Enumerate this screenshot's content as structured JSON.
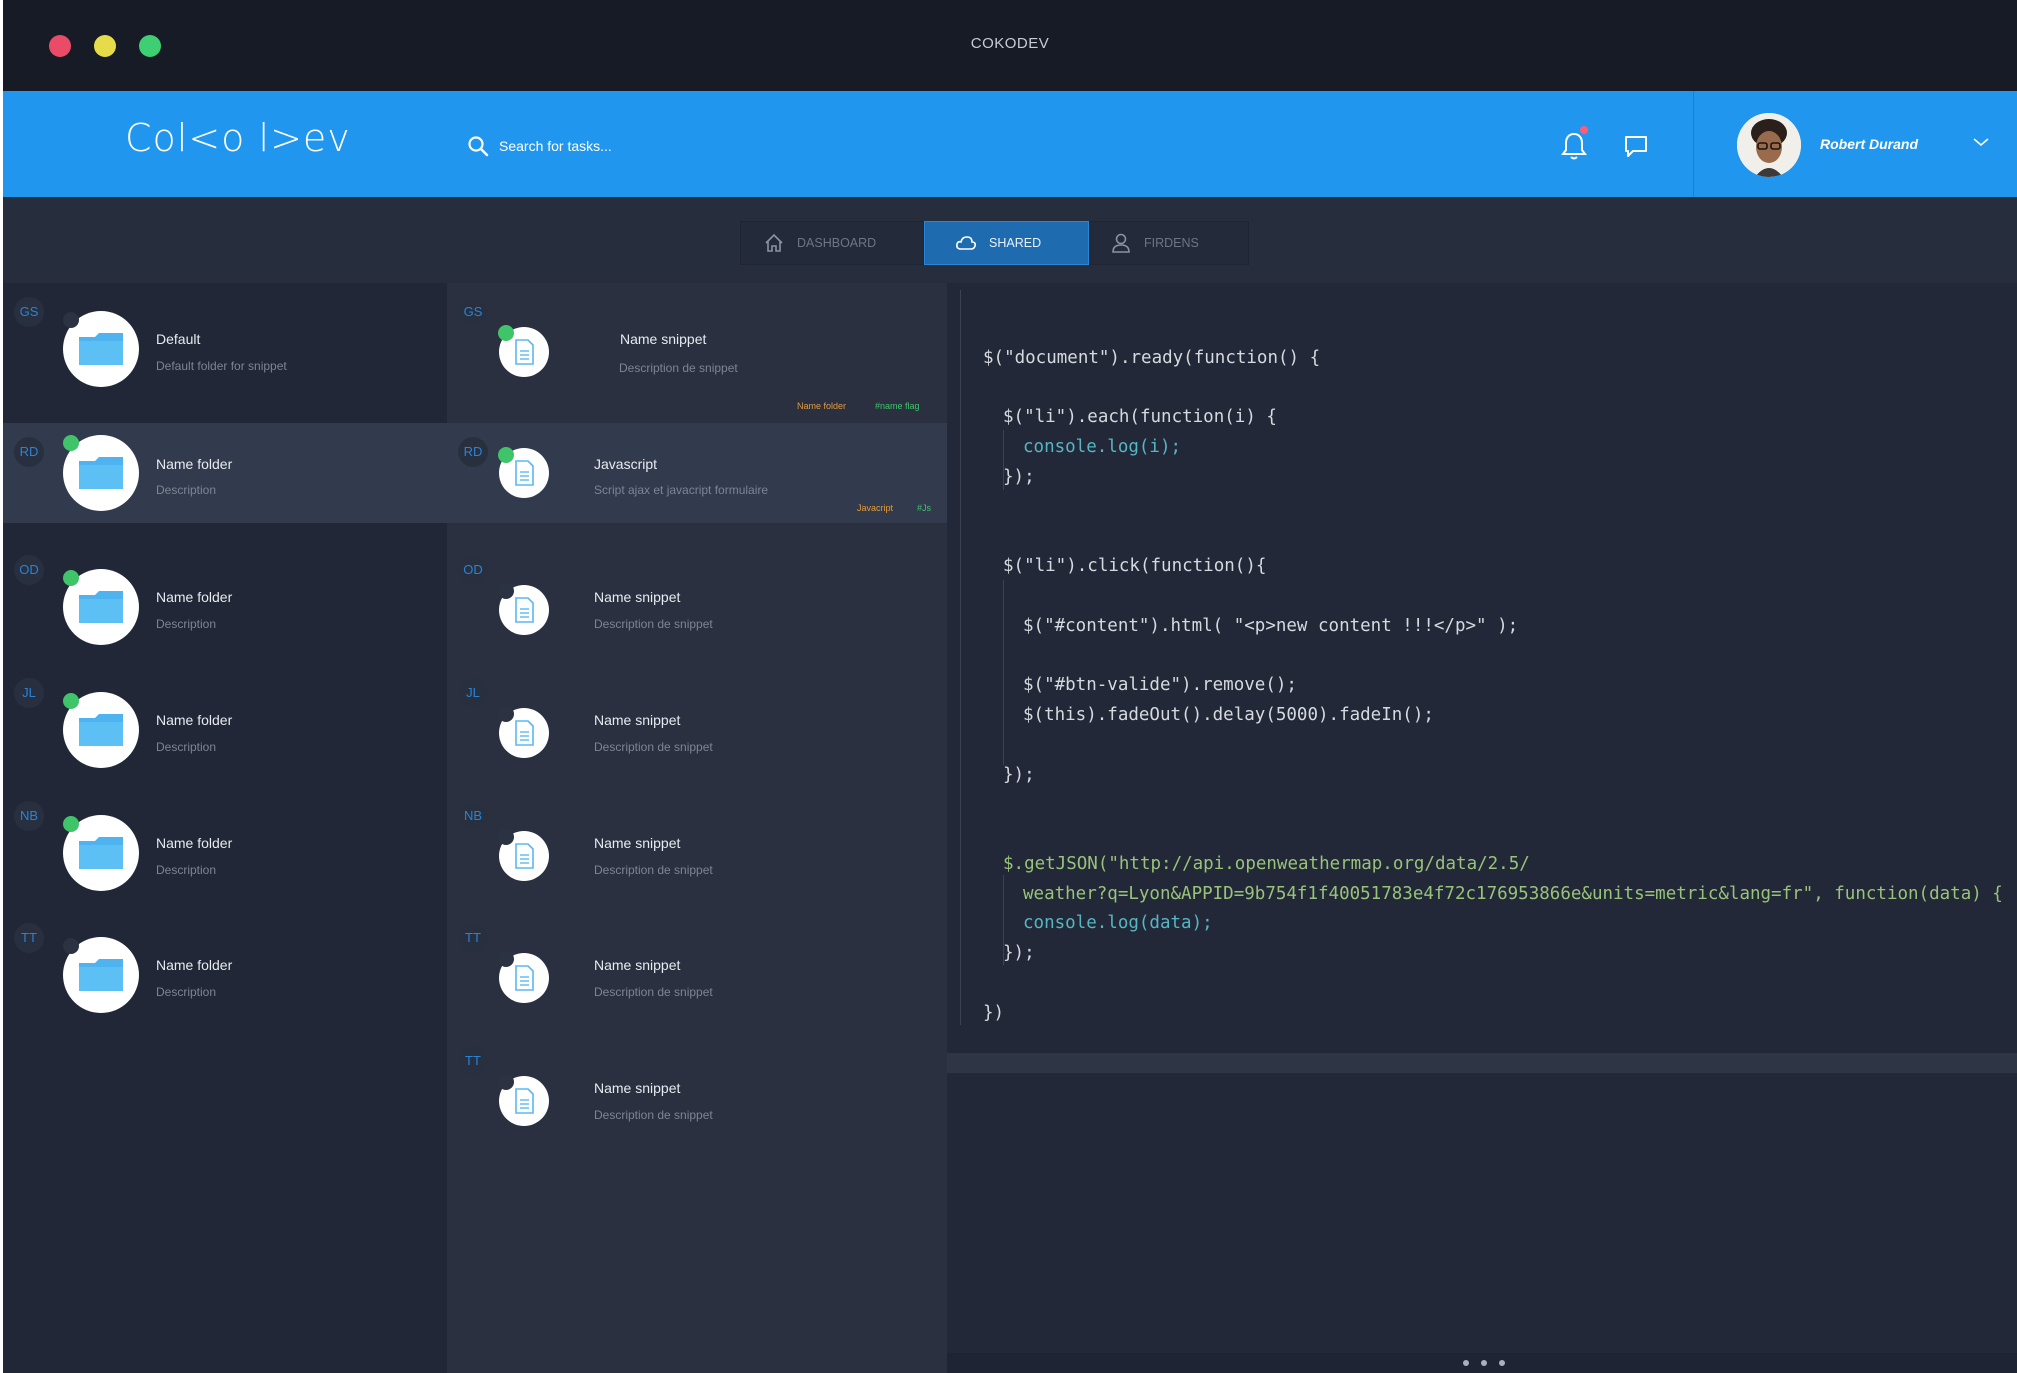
{
  "window": {
    "title": "COKODEV"
  },
  "header": {
    "logo": "Col<o l>ev",
    "search_placeholder": "Search for tasks...",
    "user_name": "Robert Durand"
  },
  "tabs": [
    {
      "label": "DASHBOARD",
      "icon": "home-icon"
    },
    {
      "label": "SHARED",
      "icon": "cloud-icon",
      "active": true
    },
    {
      "label": "FIRDENS",
      "icon": "user-icon"
    }
  ],
  "folders": [
    {
      "initials": "GS",
      "title": "Default",
      "desc": "Default folder for snippet",
      "online": false
    },
    {
      "initials": "RD",
      "title": "Name folder",
      "desc": "Description",
      "online": true
    },
    {
      "initials": "OD",
      "title": "Name folder",
      "desc": "Description",
      "online": true
    },
    {
      "initials": "JL",
      "title": "Name folder",
      "desc": "Description",
      "online": true
    },
    {
      "initials": "NB",
      "title": "Name folder",
      "desc": "Description",
      "online": true
    },
    {
      "initials": "TT",
      "title": "Name folder",
      "desc": "Description",
      "online": false
    }
  ],
  "snippets": [
    {
      "initials": "GS",
      "title": "Name snippet",
      "desc": "Description de snippet",
      "online": true,
      "tag_folder": "Name folder",
      "tag_flag": "#name flag"
    },
    {
      "initials": "RD",
      "title": "Javascript",
      "desc": "Script ajax et javacript formulaire",
      "online": true,
      "tag_folder": "Javacript",
      "tag_flag": "#Js"
    },
    {
      "initials": "OD",
      "title": "Name snippet",
      "desc": "Description de snippet",
      "online": false
    },
    {
      "initials": "JL",
      "title": "Name snippet",
      "desc": "Description de snippet",
      "online": false
    },
    {
      "initials": "NB",
      "title": "Name snippet",
      "desc": "Description de snippet",
      "online": false
    },
    {
      "initials": "TT",
      "title": "Name snippet",
      "desc": "Description de snippet",
      "online": false
    },
    {
      "initials": "TT",
      "title": "Name snippet",
      "desc": "Description de snippet",
      "online": false
    }
  ],
  "code": {
    "l1": "$(\"document\").ready(function() {",
    "l2": "$(\"li\").each(function(i) {",
    "l3": "console.log(i);",
    "l4": "});",
    "l5": "$(\"li\").click(function(){",
    "l6": "$(\"#content\").html( \"<p>new content !!!</p>\" );",
    "l7": "$(\"#btn-valide\").remove();",
    "l8": "$(this).fadeOut().delay(5000).fadeIn();",
    "l9": "});",
    "l10": "$.getJSON(\"http://api.openweathermap.org/data/2.5/",
    "l11": "weather?q=Lyon&APPID=9b754f1f40051783e4f72c176953866e&units=metric&lang=fr\", function(data) {",
    "l12": "console.log(data);",
    "l13": "});",
    "l14": "})"
  },
  "colors": {
    "brand": "#2196ee",
    "online": "#3fc46a",
    "active_tab": "#1f6bb0"
  }
}
